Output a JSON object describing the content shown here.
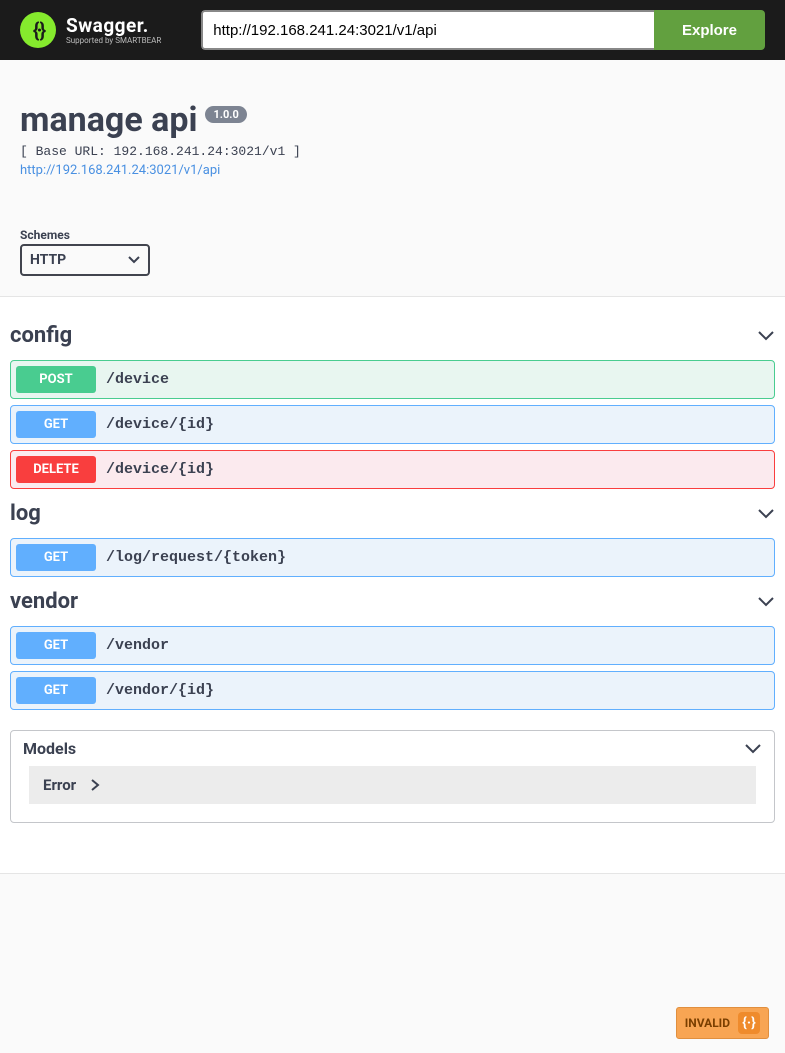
{
  "topbar": {
    "brand": "Swagger.",
    "subbrand": "Supported by SMARTBEAR",
    "url_value": "http://192.168.241.24:3021/v1/api",
    "explore_label": "Explore"
  },
  "info": {
    "title": "manage api",
    "version": "1.0.0",
    "base_url": "[ Base URL: 192.168.241.24:3021/v1 ]",
    "spec_link": "http://192.168.241.24:3021/v1/api"
  },
  "schemes": {
    "label": "Schemes",
    "selected": "HTTP",
    "options": [
      "HTTP"
    ]
  },
  "tags": [
    {
      "name": "config",
      "ops": [
        {
          "method": "POST",
          "path": "/device"
        },
        {
          "method": "GET",
          "path": "/device/{id}"
        },
        {
          "method": "DELETE",
          "path": "/device/{id}"
        }
      ]
    },
    {
      "name": "log",
      "ops": [
        {
          "method": "GET",
          "path": "/log/request/{token}"
        }
      ]
    },
    {
      "name": "vendor",
      "ops": [
        {
          "method": "GET",
          "path": "/vendor"
        },
        {
          "method": "GET",
          "path": "/vendor/{id}"
        }
      ]
    }
  ],
  "models": {
    "title": "Models",
    "items": [
      "Error"
    ]
  },
  "validator": {
    "label": "INVALID"
  }
}
